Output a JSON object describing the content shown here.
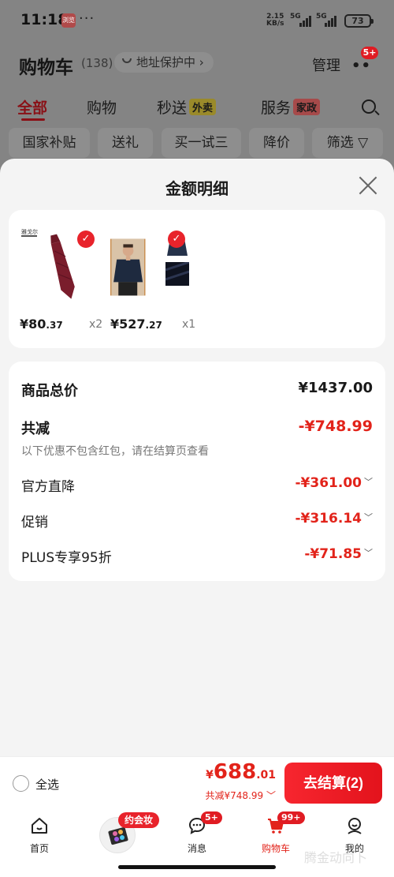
{
  "status_bar": {
    "time": "11:18",
    "app_icon_text": "浏览",
    "speed_value": "2.15",
    "speed_unit": "KB/s",
    "sig1": "5G",
    "sig2": "5G",
    "battery": "73"
  },
  "header": {
    "title": "购物车",
    "count": "(138)",
    "address_chip": "地址保护中",
    "manage": "管理",
    "more_badge": "5+"
  },
  "categories": [
    {
      "label": "全部"
    },
    {
      "label": "购物"
    },
    {
      "label": "秒送",
      "tag": "外卖"
    },
    {
      "label": "服务",
      "tag": "家政"
    }
  ],
  "filters": [
    "国家补贴",
    "送礼",
    "买一试三",
    "降价",
    "筛选"
  ],
  "sheet": {
    "title": "金额明细",
    "products": [
      {
        "price_int": "¥80",
        "price_dec": ".37",
        "qty": "x2",
        "brand": "雅戈尔"
      },
      {
        "price_int": "¥527",
        "price_dec": ".27",
        "qty": "x1"
      }
    ],
    "total_label": "商品总价",
    "total_value": "¥1437.00",
    "reduce_label": "共减",
    "reduce_value": "-¥748.99",
    "reduce_note": "以下优惠不包含红包，请在结算页查看",
    "discounts": [
      {
        "label": "官方直降",
        "value": "-¥361.00"
      },
      {
        "label": "促销",
        "value": "-¥316.14"
      },
      {
        "label": "PLUS专享95折",
        "value": "-¥71.85"
      }
    ]
  },
  "checkout": {
    "select_all": "全选",
    "currency": "¥",
    "total_int": "688",
    "total_dec": ".01",
    "saved": "共减¥748.99",
    "pay_button": "去结算(2)"
  },
  "tabbar": {
    "promo": "约会妆",
    "items": [
      {
        "label": "首页"
      },
      {
        "label": "消息",
        "badge": "5+"
      },
      {
        "label": "购物车",
        "badge": "99+"
      },
      {
        "label": "我的"
      }
    ]
  },
  "watermark": "腾金动向卜",
  "colors": {
    "accent": "#e2231a",
    "pay_button": "#f2232b",
    "sheet_bg": "#f4f4f4"
  }
}
